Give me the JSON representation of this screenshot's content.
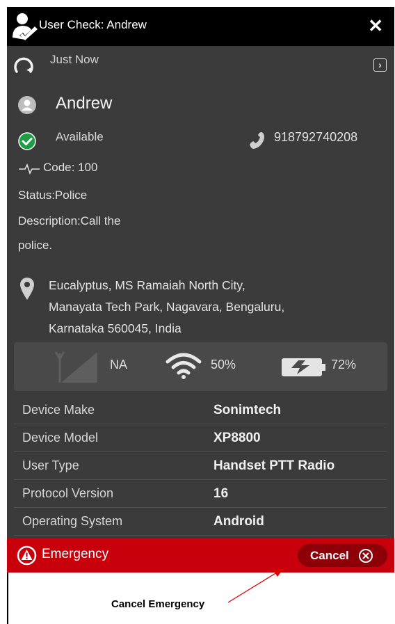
{
  "window": {
    "title": "User Check: Andrew",
    "close_symbol": "✕"
  },
  "refresh": {
    "label": "Just Now",
    "expand_symbol": "›"
  },
  "user": {
    "name": "Andrew",
    "status": "Available",
    "status_color": "#1e9e44",
    "phone": "918792740208",
    "code": "Code: 100",
    "status_line": "Status:Police",
    "description_line1": "Description:Call the",
    "description_line2": "police."
  },
  "address": {
    "line1": "Eucalyptus, MS Ramaiah North City,",
    "line2": "Manayata Tech Park, Nagavara, Bengaluru,",
    "line3": "Karnataka 560045, India"
  },
  "signals": {
    "network": "NA",
    "wifi": "50%",
    "wifi_level": 0.5,
    "battery": "72%",
    "battery_level": 0.72
  },
  "device_info": [
    {
      "key": "Device Make",
      "value": "Sonimtech"
    },
    {
      "key": "Device Model",
      "value": "XP8800"
    },
    {
      "key": "User Type",
      "value": "Handset PTT Radio"
    },
    {
      "key": "Protocol Version",
      "value": "16"
    },
    {
      "key": "Operating System",
      "value": "Android"
    }
  ],
  "emergency": {
    "label": "Emergency",
    "cancel_label": "Cancel",
    "bar_color": "#c8000b"
  },
  "annotation": {
    "label": "Cancel Emergency",
    "arrow_color": "#e00000"
  }
}
